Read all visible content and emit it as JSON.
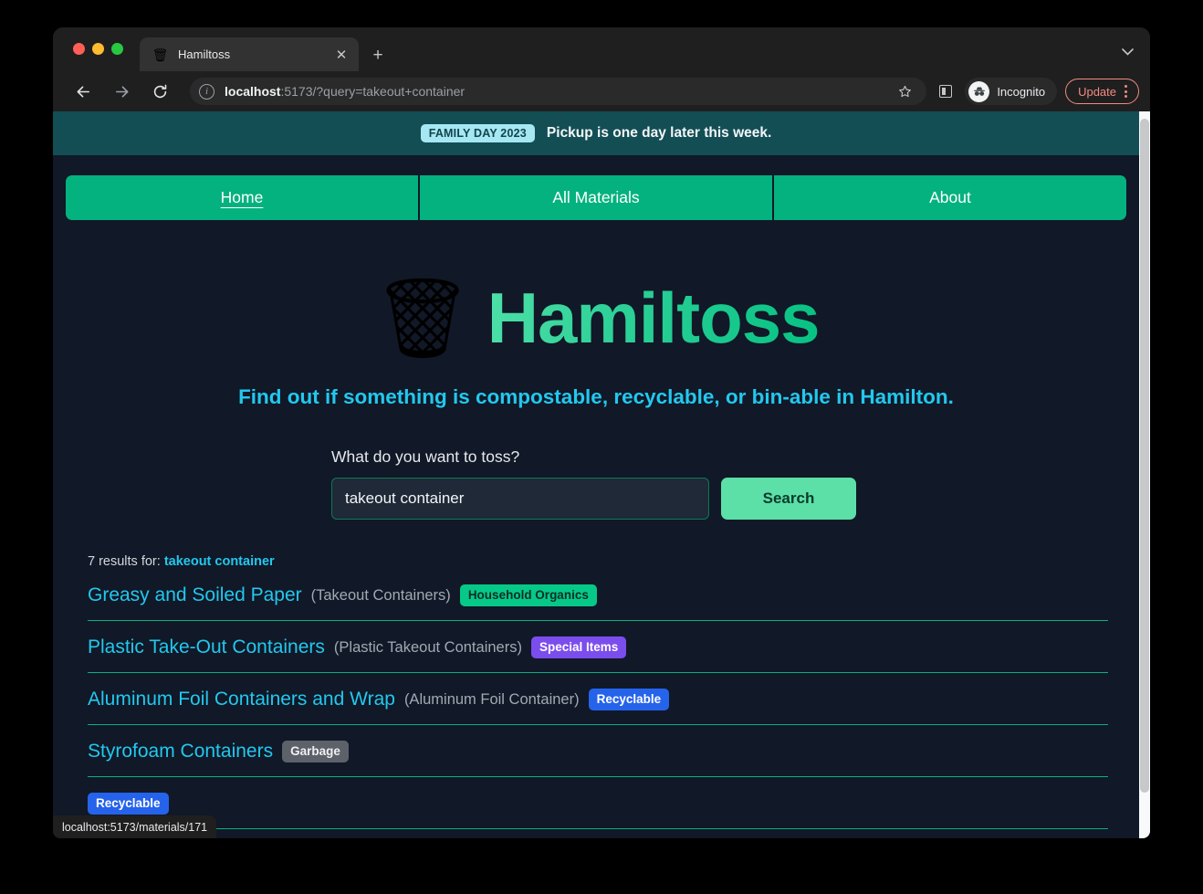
{
  "browser": {
    "tab": {
      "title": "Hamiltoss",
      "favicon": "trash-can-icon",
      "close_label": "✕"
    },
    "new_tab_label": "+",
    "omnibox": {
      "host": "localhost",
      "rest": ":5173/?query=takeout+container",
      "site_info_icon": "info-icon"
    },
    "profile": {
      "label": "Incognito"
    },
    "update": {
      "label": "Update"
    },
    "status_bubble": "localhost:5173/materials/171"
  },
  "page": {
    "banner": {
      "badge": "FAMILY DAY 2023",
      "message": "Pickup is one day later this week."
    },
    "nav": {
      "items": [
        {
          "label": "Home",
          "active": true
        },
        {
          "label": "All Materials",
          "active": false
        },
        {
          "label": "About",
          "active": false
        }
      ]
    },
    "hero": {
      "logo": "🗑",
      "title": "Hamiltoss",
      "tagline": "Find out if something is compostable, recyclable, or bin-able in Hamilton."
    },
    "search": {
      "label": "What do you want to toss?",
      "value": "takeout container",
      "placeholder": "",
      "button": "Search"
    },
    "results": {
      "count_prefix": "7 results for: ",
      "query": "takeout container",
      "rows": [
        {
          "name": "Greasy and Soiled Paper",
          "alias": "(Takeout Containers)",
          "badge": "Household Organics",
          "badge_class": "badge-organics"
        },
        {
          "name": "Plastic Take-Out Containers",
          "alias": "(Plastic Takeout Containers)",
          "badge": "Special Items",
          "badge_class": "badge-special"
        },
        {
          "name": "Aluminum Foil Containers and Wrap",
          "alias": "(Aluminum Foil Container)",
          "badge": "Recyclable",
          "badge_class": "badge-recyclable"
        },
        {
          "name": "Styrofoam Containers",
          "alias": "",
          "badge": "Garbage",
          "badge_class": "badge-garbage"
        },
        {
          "name": "",
          "alias": "",
          "badge": "Recyclable",
          "badge_class": "badge-recyclable"
        }
      ]
    }
  },
  "colors": {
    "brand_green": "#04b27f",
    "accent_cyan": "#22c8ee",
    "banner_teal": "#134e55",
    "page_bg": "#111827"
  }
}
